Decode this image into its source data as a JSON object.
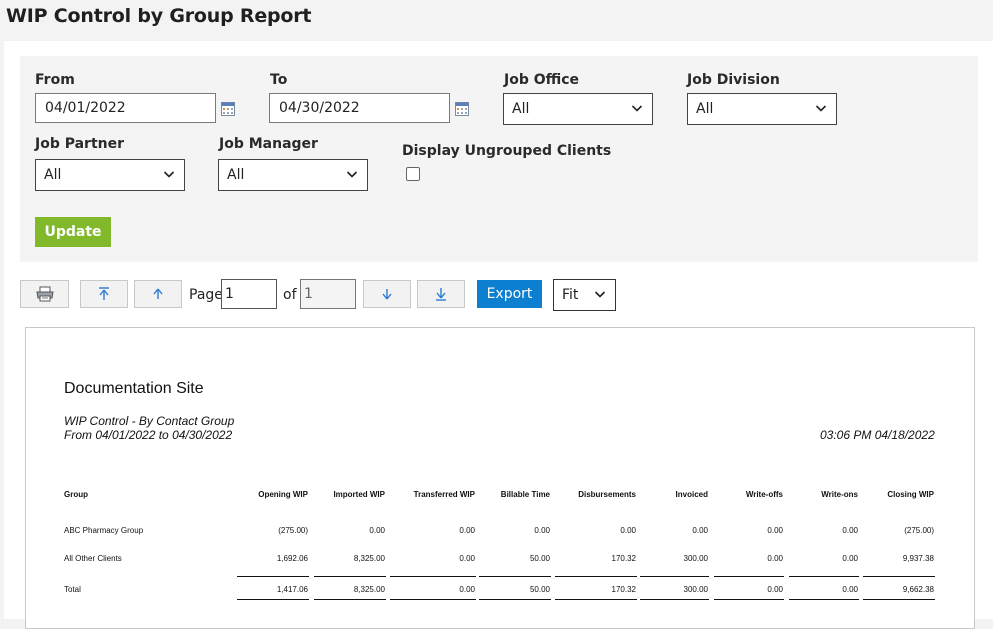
{
  "title": "WIP Control by Group Report",
  "filters": {
    "from_label": "From",
    "from_value": "04/01/2022",
    "to_label": "To",
    "to_value": "04/30/2022",
    "job_office_label": "Job Office",
    "job_office_value": "All",
    "job_division_label": "Job Division",
    "job_division_value": "All",
    "job_partner_label": "Job Partner",
    "job_partner_value": "All",
    "job_manager_label": "Job Manager",
    "job_manager_value": "All",
    "ungrouped_label": "Display Ungrouped Clients",
    "ungrouped_checked": false,
    "update_label": "Update"
  },
  "toolbar": {
    "page_label": "Page",
    "page_value": "1",
    "of_label": "of",
    "total_pages": "1",
    "export_label": "Export",
    "zoom_value": "Fit"
  },
  "report": {
    "site": "Documentation Site",
    "subtitle": "WIP Control - By Contact Group",
    "range": "From 04/01/2022 to 04/30/2022",
    "timestamp": "03:06 PM 04/18/2022",
    "columns": [
      "Group",
      "Opening WIP",
      "Imported WIP",
      "Transferred WIP",
      "Billable Time",
      "Disbursements",
      "Invoiced",
      "Write-offs",
      "Write-ons",
      "Closing WIP"
    ],
    "rows": [
      [
        "ABC Pharmacy Group",
        "(275.00)",
        "0.00",
        "0.00",
        "0.00",
        "0.00",
        "0.00",
        "0.00",
        "0.00",
        "(275.00)"
      ],
      [
        "All Other Clients",
        "1,692.06",
        "8,325.00",
        "0.00",
        "50.00",
        "170.32",
        "300.00",
        "0.00",
        "0.00",
        "9,937.38"
      ]
    ],
    "total": [
      "Total",
      "1,417.06",
      "8,325.00",
      "0.00",
      "50.00",
      "170.32",
      "300.00",
      "0.00",
      "0.00",
      "9,662.38"
    ]
  }
}
